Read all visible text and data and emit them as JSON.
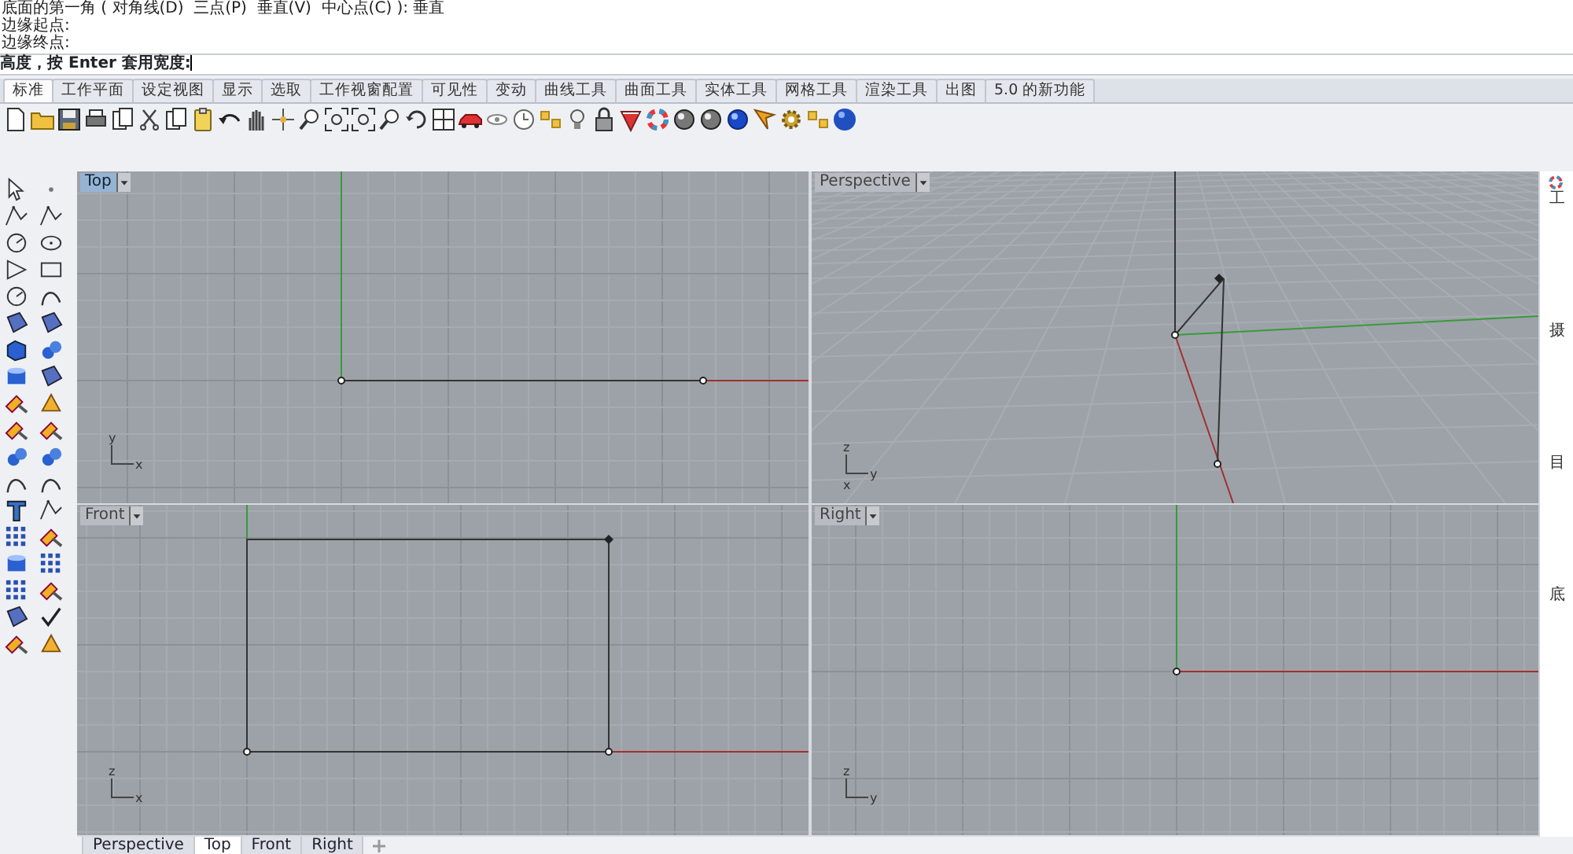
{
  "command_history": [
    "底面的第一角 ( 对角线(D)  三点(P)  垂直(V)  中心点(C) ): 垂直",
    "边缘起点:",
    "边缘终点:"
  ],
  "command_prompt": "高度，按 Enter 套用宽度:",
  "tabs": [
    {
      "label": "标准",
      "selected": true
    },
    {
      "label": "工作平面",
      "selected": false
    },
    {
      "label": "设定视图",
      "selected": false
    },
    {
      "label": "显示",
      "selected": false
    },
    {
      "label": "选取",
      "selected": false
    },
    {
      "label": "工作视窗配置",
      "selected": false
    },
    {
      "label": "可见性",
      "selected": false
    },
    {
      "label": "变动",
      "selected": false
    },
    {
      "label": "曲线工具",
      "selected": false
    },
    {
      "label": "曲面工具",
      "selected": false
    },
    {
      "label": "实体工具",
      "selected": false
    },
    {
      "label": "网格工具",
      "selected": false
    },
    {
      "label": "渲染工具",
      "selected": false
    },
    {
      "label": "出图",
      "selected": false
    },
    {
      "label": "5.0 的新功能",
      "selected": false
    }
  ],
  "viewports": [
    {
      "title": "Top",
      "kind": "top",
      "selected": true,
      "axes": [
        "y",
        "x"
      ]
    },
    {
      "title": "Perspective",
      "kind": "perspective",
      "selected": false,
      "axes": [
        "z",
        "y",
        "x"
      ]
    },
    {
      "title": "Front",
      "kind": "front",
      "selected": false,
      "axes": [
        "z",
        "x"
      ]
    },
    {
      "title": "Right",
      "kind": "right",
      "selected": false,
      "axes": [
        "z",
        "y"
      ]
    }
  ],
  "viewport_tabs": [
    {
      "label": "Perspective",
      "selected": false
    },
    {
      "label": "Top",
      "selected": true
    },
    {
      "label": "Front",
      "selected": false
    },
    {
      "label": "Right",
      "selected": false
    }
  ],
  "side_panel": {
    "labels": [
      "工",
      "摄",
      "目",
      "底"
    ]
  }
}
